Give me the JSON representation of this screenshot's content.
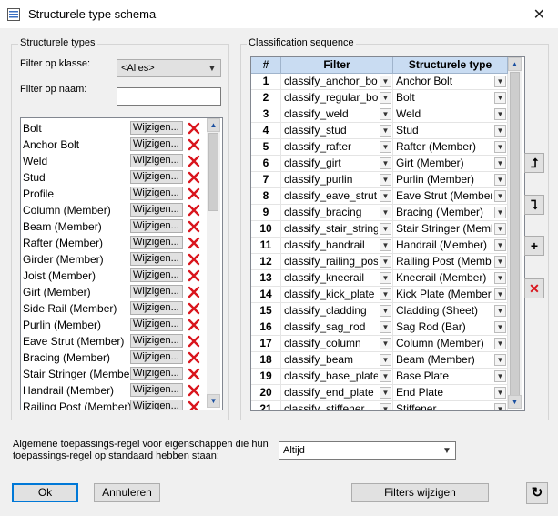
{
  "window": {
    "title": "Structurele type schema",
    "close_glyph": "✕"
  },
  "left_panel": {
    "legend": "Structurele types",
    "filter_class_label": "Filter op klasse:",
    "filter_class_value": "<Alles>",
    "filter_name_label": "Filter op naam:",
    "filter_name_value": "",
    "edit_label": "Wijzigen...",
    "items": [
      "Bolt",
      "Anchor Bolt",
      "Weld",
      "Stud",
      "Profile",
      "Column (Member)",
      "Beam (Member)",
      "Rafter (Member)",
      "Girder (Member)",
      "Joist (Member)",
      "Girt (Member)",
      "Side Rail (Member)",
      "Purlin (Member)",
      "Eave Strut (Member)",
      "Bracing (Member)",
      "Stair Stringer (Member)",
      "Handrail (Member)",
      "Railing Post (Member)"
    ]
  },
  "right_panel": {
    "legend": "Classification sequence",
    "columns": [
      "#",
      "Filter",
      "Structurele type"
    ],
    "rows": [
      [
        "1",
        "classify_anchor_bolt",
        "Anchor Bolt"
      ],
      [
        "2",
        "classify_regular_bolt",
        "Bolt"
      ],
      [
        "3",
        "classify_weld",
        "Weld"
      ],
      [
        "4",
        "classify_stud",
        "Stud"
      ],
      [
        "5",
        "classify_rafter",
        "Rafter (Member)"
      ],
      [
        "6",
        "classify_girt",
        "Girt (Member)"
      ],
      [
        "7",
        "classify_purlin",
        "Purlin (Member)"
      ],
      [
        "8",
        "classify_eave_strut",
        "Eave Strut (Member)"
      ],
      [
        "9",
        "classify_bracing",
        "Bracing (Member)"
      ],
      [
        "10",
        "classify_stair_stringer",
        "Stair Stringer (Member)"
      ],
      [
        "11",
        "classify_handrail",
        "Handrail (Member)"
      ],
      [
        "12",
        "classify_railing_post",
        "Railing Post (Member)"
      ],
      [
        "13",
        "classify_kneerail",
        "Kneerail (Member)"
      ],
      [
        "14",
        "classify_kick_plate",
        "Kick Plate (Member)"
      ],
      [
        "15",
        "classify_cladding",
        "Cladding (Sheet)"
      ],
      [
        "16",
        "classify_sag_rod",
        "Sag Rod (Bar)"
      ],
      [
        "17",
        "classify_column",
        "Column (Member)"
      ],
      [
        "18",
        "classify_beam",
        "Beam (Member)"
      ],
      [
        "19",
        "classify_base_plate",
        "Base Plate"
      ],
      [
        "20",
        "classify_end_plate",
        "End Plate"
      ],
      [
        "21",
        "classify_stiffener",
        "Stiffener"
      ]
    ],
    "side_buttons": {
      "move_up": "⮥",
      "move_down": "⮧",
      "add": "+",
      "delete": "✕"
    }
  },
  "bottom": {
    "rule_label": "Algemene toepassings-regel voor eigenschappen die hun toepassings-regel op standaard hebben staan:",
    "rule_value": "Altijd",
    "ok_label": "Ok",
    "cancel_label": "Annuleren",
    "filters_label": "Filters wijzigen",
    "refresh_glyph": "↻"
  },
  "colors": {
    "accent": "#0078d7",
    "header_bg": "#c9dcf2",
    "delete_red": "#d9141c"
  }
}
